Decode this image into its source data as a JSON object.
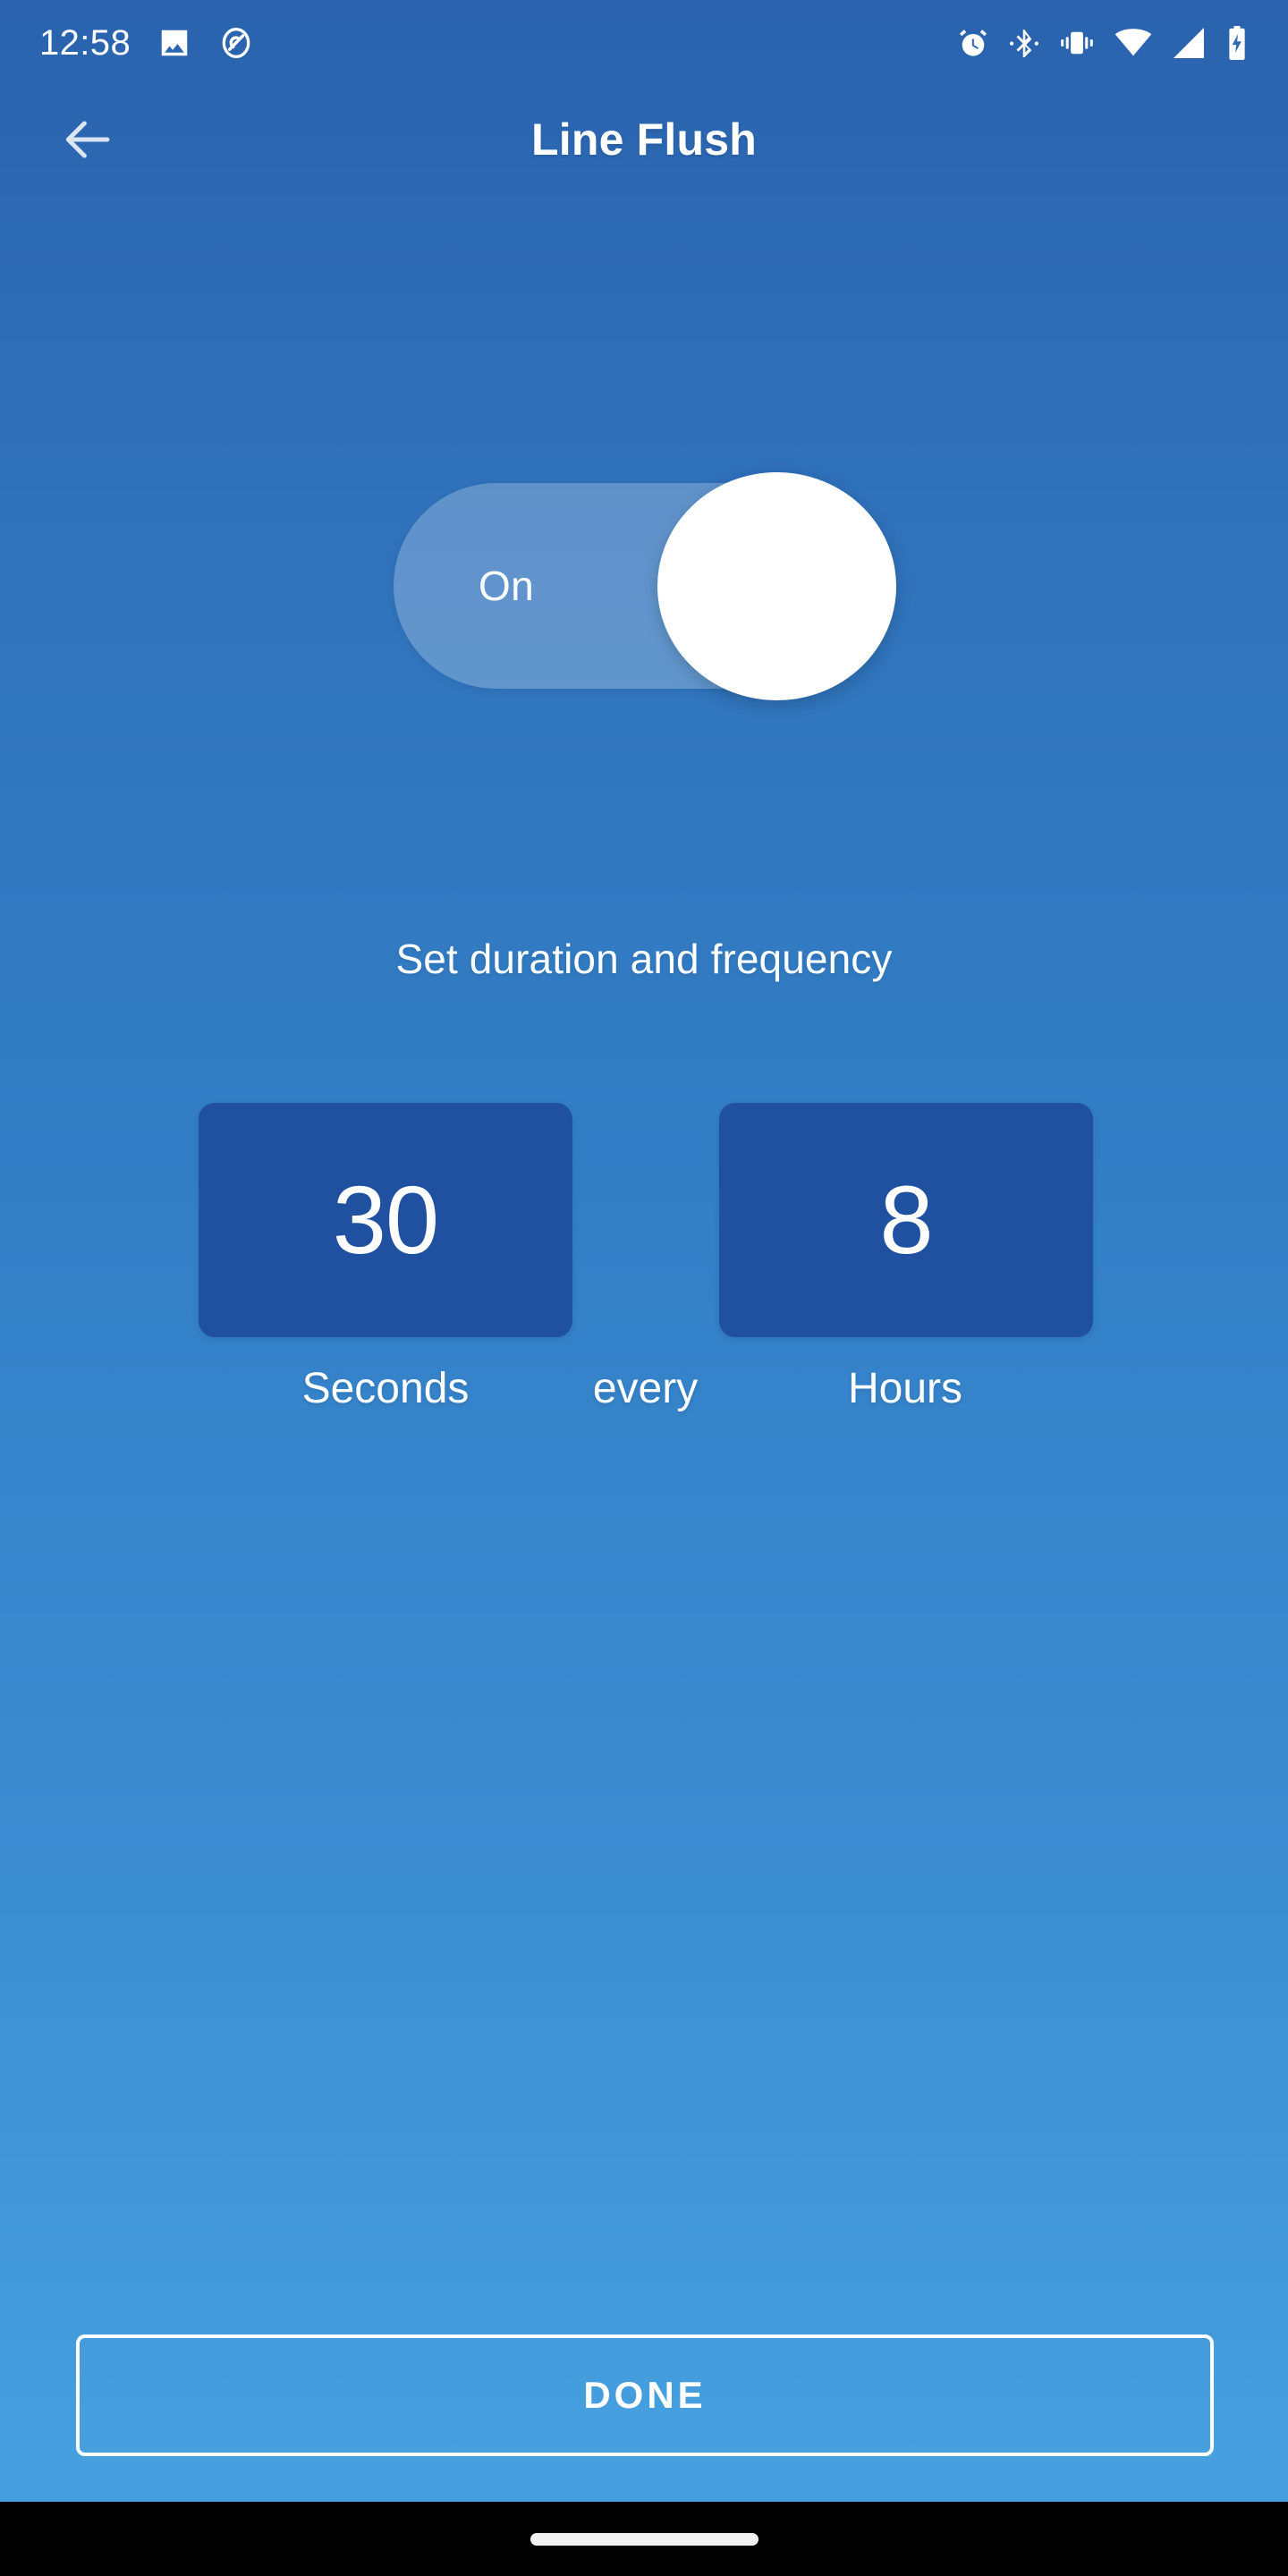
{
  "status_bar": {
    "time": "12:58",
    "left_icons": [
      {
        "name": "image-icon",
        "glyph": "image"
      },
      {
        "name": "screen-record-icon",
        "glyph": "circle-q"
      }
    ],
    "right_icons": [
      {
        "name": "alarm-icon",
        "glyph": "alarm"
      },
      {
        "name": "bluetooth-icon",
        "glyph": "bluetooth"
      },
      {
        "name": "vibrate-icon",
        "glyph": "vibrate"
      },
      {
        "name": "wifi-icon",
        "glyph": "wifi"
      },
      {
        "name": "cellular-signal-icon",
        "glyph": "signal"
      },
      {
        "name": "battery-charging-icon",
        "glyph": "battery-charging"
      }
    ]
  },
  "app_bar": {
    "back_icon": "arrow-left-icon",
    "title": "Line Flush"
  },
  "toggle": {
    "label": "On",
    "state": "on"
  },
  "settings": {
    "caption": "Set duration and frequency",
    "duration": {
      "value": "30",
      "unit": "Seconds"
    },
    "connector": "every",
    "frequency": {
      "value": "8",
      "unit": "Hours"
    }
  },
  "actions": {
    "done_label": "DONE"
  },
  "colors": {
    "background_top": "#2a62ad",
    "background_bottom": "#46a0df",
    "value_box": "#1f51a0",
    "toggle_track": "rgba(255,255,255,0.24)",
    "toggle_thumb": "#ffffff",
    "text_primary": "#ffffff",
    "nav_bar": "#000000"
  }
}
